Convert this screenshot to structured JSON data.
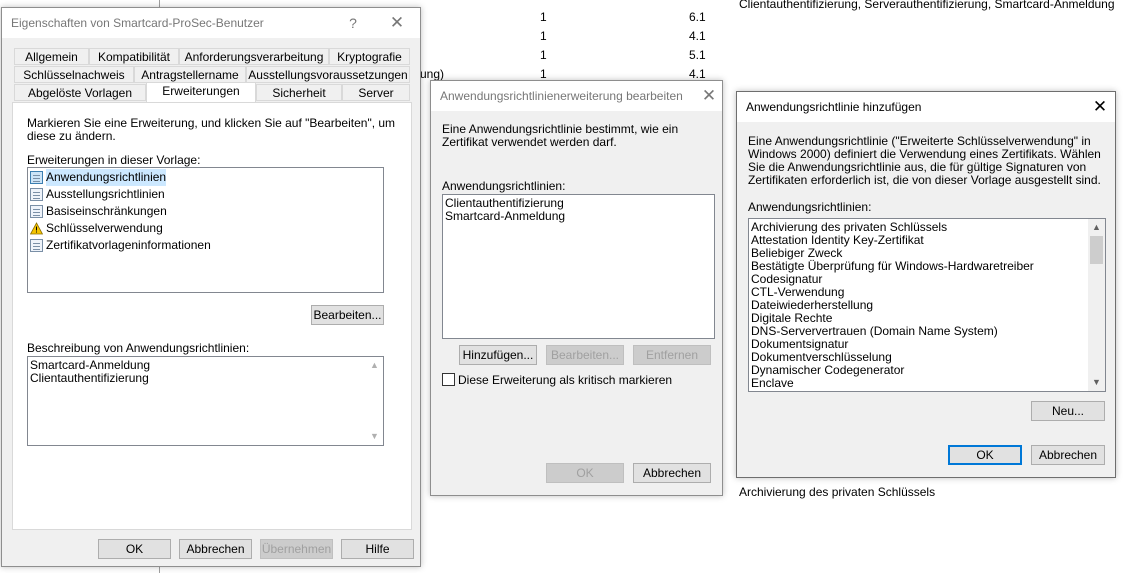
{
  "background": {
    "rows": [
      {
        "c2": "1",
        "c3": "6.1",
        "c4": "Clientauthentifizierung, Serverauthentifizierung, Smartcard-Anmeldung"
      },
      {
        "c2": "1",
        "c3": "4.1",
        "c4": ""
      },
      {
        "c2": "1",
        "c3": "5.1",
        "c4": ""
      },
      {
        "c2": "1",
        "c3": "4.1",
        "c4": ""
      }
    ],
    "fragment": "ung)",
    "bottom_text": "Archivierung des privaten Schlüssels"
  },
  "dialog1": {
    "title": "Eigenschaften von Smartcard-ProSec-Benutzer",
    "help": "?",
    "close": "✕",
    "tabs_row1": [
      "Allgemein",
      "Kompatibilität",
      "Anforderungsverarbeitung",
      "Kryptografie"
    ],
    "tabs_row2": [
      "Schlüsselnachweis",
      "Antragstellername",
      "Ausstellungsvoraussetzungen"
    ],
    "tabs_row3": [
      "Abgelöste Vorlagen",
      "Erweiterungen",
      "Sicherheit",
      "Server"
    ],
    "instruction": "Markieren Sie eine Erweiterung, und klicken Sie auf \"Bearbeiten\", um diese zu ändern.",
    "ext_label": "Erweiterungen in dieser Vorlage:",
    "extensions": [
      {
        "label": "Anwendungsrichtlinien",
        "icon": "document-icon"
      },
      {
        "label": "Ausstellungsrichtlinien",
        "icon": "document-icon"
      },
      {
        "label": "Basiseinschränkungen",
        "icon": "document-icon"
      },
      {
        "label": "Schlüsselverwendung",
        "icon": "warning-icon"
      },
      {
        "label": "Zertifikatvorlageninformationen",
        "icon": "document-icon"
      }
    ],
    "edit_button": "Bearbeiten...",
    "desc_label": "Beschreibung von Anwendungsrichtlinien:",
    "desc_lines": [
      "Smartcard-Anmeldung",
      "Clientauthentifizierung"
    ],
    "ok": "OK",
    "cancel": "Abbrechen",
    "apply": "Übernehmen",
    "help_button": "Hilfe"
  },
  "dialog2": {
    "title": "Anwendungsrichtlinienerweiterung bearbeiten",
    "close": "✕",
    "description": "Eine Anwendungsrichtlinie bestimmt, wie ein Zertifikat verwendet werden darf.",
    "list_label": "Anwendungsrichtlinien:",
    "items": [
      "Clientauthentifizierung",
      "Smartcard-Anmeldung"
    ],
    "add": "Hinzufügen...",
    "edit": "Bearbeiten...",
    "remove": "Entfernen",
    "critical_label": "Diese Erweiterung als kritisch markieren",
    "ok": "OK",
    "cancel": "Abbrechen"
  },
  "dialog3": {
    "title": "Anwendungsrichtlinie hinzufügen",
    "close": "✕",
    "description": "Eine Anwendungsrichtlinie (\"Erweiterte Schlüsselverwendung\" in Windows 2000) definiert die Verwendung eines Zertifikats. Wählen Sie die Anwendungsrichtlinie aus, die für gültige Signaturen von Zertifikaten erforderlich ist, die von dieser Vorlage ausgestellt sind.",
    "list_label": "Anwendungsrichtlinien:",
    "items": [
      "Archivierung des privaten Schlüssels",
      "Attestation Identity Key-Zertifikat",
      "Beliebiger Zweck",
      "Bestätigte Überprüfung für Windows-Hardwaretreiber",
      "Codesignatur",
      "CTL-Verwendung",
      "Dateiwiederherstellung",
      "Digitale Rechte",
      "DNS-Serververtrauen (Domain Name System)",
      "Dokumentsignatur",
      "Dokumentverschlüsselung",
      "Dynamischer Codegenerator",
      "Enclave"
    ],
    "new": "Neu...",
    "ok": "OK",
    "cancel": "Abbrechen"
  }
}
